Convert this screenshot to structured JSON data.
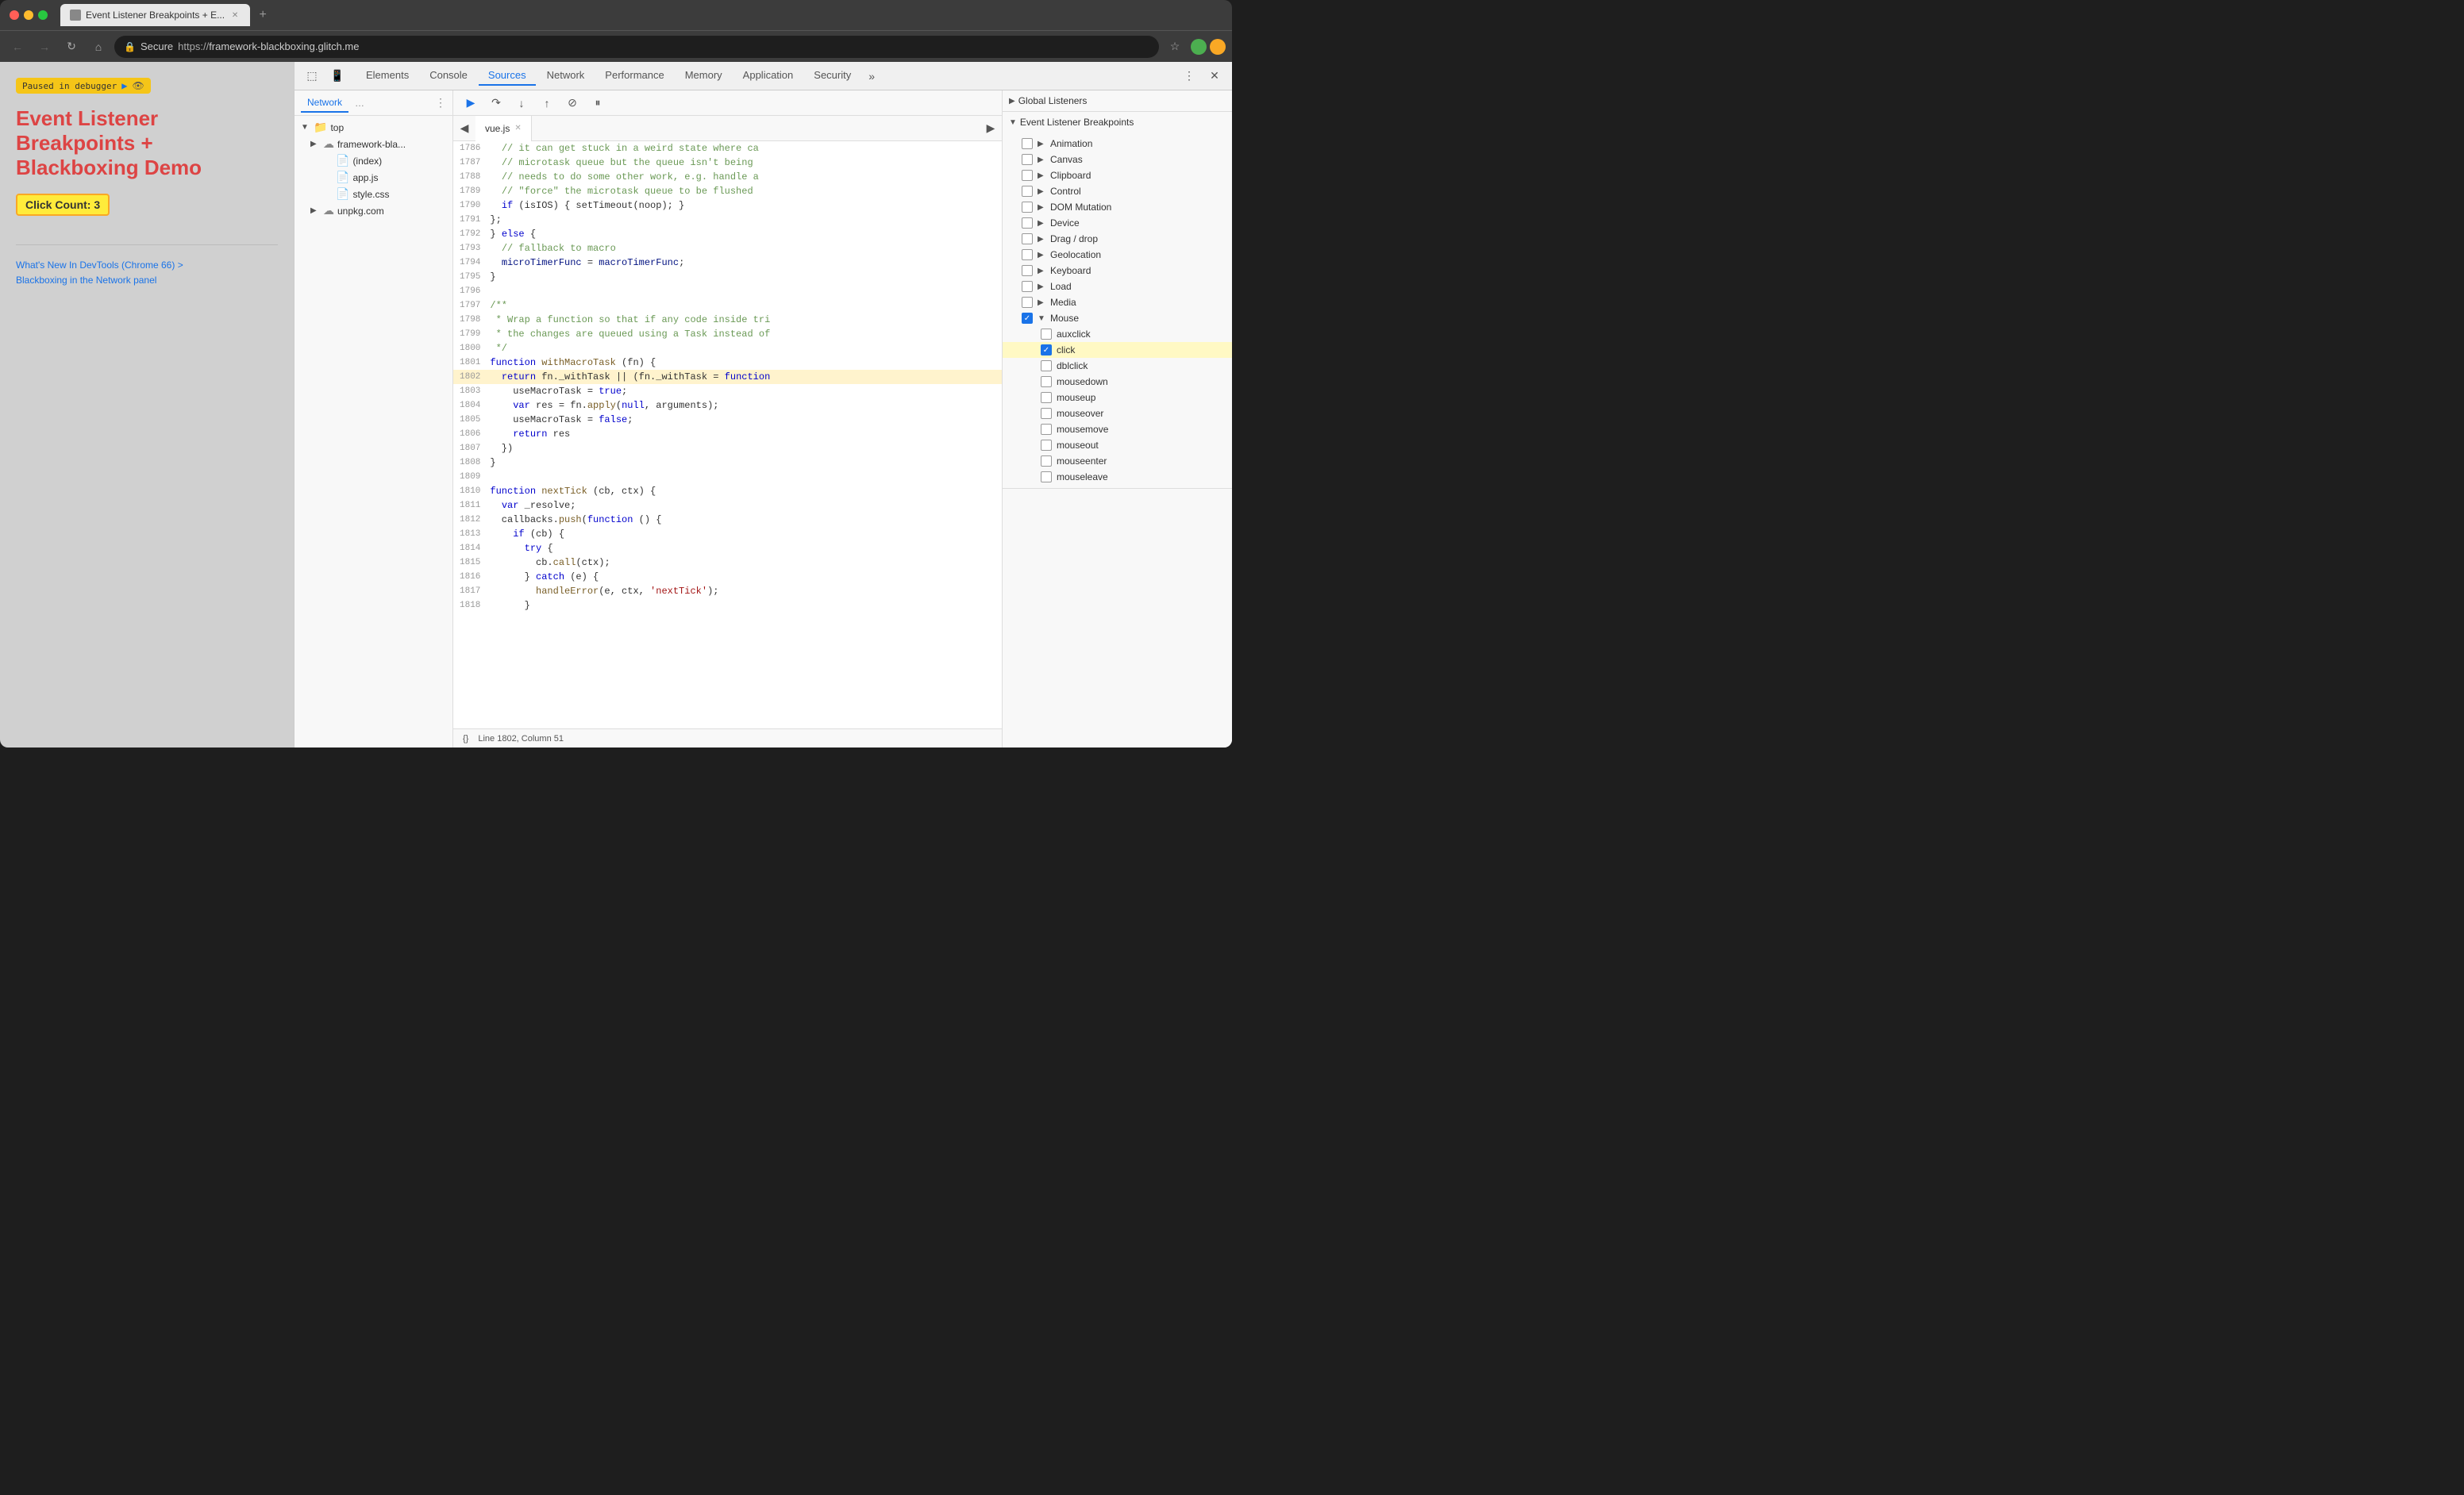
{
  "browser": {
    "title": "Event Listener Breakpoints + E...",
    "url": {
      "protocol": "https://",
      "domain": "framework-blackboxing.glitch.me"
    },
    "secure_label": "Secure"
  },
  "devtools": {
    "tabs": [
      "Elements",
      "Console",
      "Sources",
      "Network",
      "Performance",
      "Memory",
      "Application",
      "Security"
    ],
    "active_tab": "Sources"
  },
  "page": {
    "paused_label": "Paused in debugger",
    "title": "Event Listener Breakpoints + Blackboxing Demo",
    "click_count_label": "Click Count: 3",
    "links": [
      "What's New In DevTools (Chrome 66) >",
      "Blackboxing in the Network panel"
    ]
  },
  "sources_sidebar": {
    "tabs": [
      "Network",
      "..."
    ],
    "tree": [
      {
        "level": 0,
        "type": "folder",
        "label": "top",
        "arrow": "▼"
      },
      {
        "level": 1,
        "type": "cloud-folder",
        "label": "framework-bla...",
        "arrow": "▶"
      },
      {
        "level": 2,
        "type": "file-blue",
        "label": "(index)"
      },
      {
        "level": 2,
        "type": "file-yellow",
        "label": "app.js"
      },
      {
        "level": 2,
        "type": "file-yellow",
        "label": "style.css"
      },
      {
        "level": 1,
        "type": "cloud-folder",
        "label": "unpkg.com",
        "arrow": "▶"
      }
    ]
  },
  "editor": {
    "file_tab": "vue.js",
    "lines": [
      {
        "num": "1786",
        "code": "  // it can get stuck in a weird state where ca",
        "type": "comment"
      },
      {
        "num": "1787",
        "code": "  // microtask queue but the queue isn't being",
        "type": "comment"
      },
      {
        "num": "1788",
        "code": "  // needs to do some other work, e.g. handle a",
        "type": "comment"
      },
      {
        "num": "1789",
        "code": "  // \"force\" the microtask queue to be flushed",
        "type": "comment"
      },
      {
        "num": "1790",
        "code": "  if (isIOS) { setTimeout(noop); }",
        "type": "code"
      },
      {
        "num": "1791",
        "code": "};",
        "type": "code"
      },
      {
        "num": "1792",
        "code": "} else {",
        "type": "code"
      },
      {
        "num": "1793",
        "code": "  // fallback to macro",
        "type": "comment"
      },
      {
        "num": "1794",
        "code": "  microTimerFunc = macroTimerFunc;",
        "type": "code"
      },
      {
        "num": "1795",
        "code": "}",
        "type": "code"
      },
      {
        "num": "1796",
        "code": "",
        "type": "code"
      },
      {
        "num": "1797",
        "code": "/**",
        "type": "comment"
      },
      {
        "num": "1798",
        "code": " * Wrap a function so that if any code inside tri",
        "type": "comment"
      },
      {
        "num": "1799",
        "code": " * the changes are queued using a Task instead of",
        "type": "comment"
      },
      {
        "num": "1800",
        "code": " */",
        "type": "comment"
      },
      {
        "num": "1801",
        "code": "function withMacroTask (fn) {",
        "type": "code"
      },
      {
        "num": "1802",
        "code": "  return fn._withTask || (fn._withTask = function",
        "type": "highlighted"
      },
      {
        "num": "1803",
        "code": "    useMacroTask = true;",
        "type": "code"
      },
      {
        "num": "1804",
        "code": "    var res = fn.apply(null, arguments);",
        "type": "code"
      },
      {
        "num": "1805",
        "code": "    useMacroTask = false;",
        "type": "code"
      },
      {
        "num": "1806",
        "code": "    return res",
        "type": "code"
      },
      {
        "num": "1807",
        "code": "  })",
        "type": "code"
      },
      {
        "num": "1808",
        "code": "}",
        "type": "code"
      },
      {
        "num": "1809",
        "code": "",
        "type": "code"
      },
      {
        "num": "1810",
        "code": "function nextTick (cb, ctx) {",
        "type": "code"
      },
      {
        "num": "1811",
        "code": "  var _resolve;",
        "type": "code"
      },
      {
        "num": "1812",
        "code": "  callbacks.push(function () {",
        "type": "code"
      },
      {
        "num": "1813",
        "code": "    if (cb) {",
        "type": "code"
      },
      {
        "num": "1814",
        "code": "      try {",
        "type": "code"
      },
      {
        "num": "1815",
        "code": "        cb.call(ctx);",
        "type": "code"
      },
      {
        "num": "1816",
        "code": "      } catch (e) {",
        "type": "code"
      },
      {
        "num": "1817",
        "code": "        handleError(e, ctx, 'nextTick');",
        "type": "code"
      },
      {
        "num": "1818",
        "code": "      }",
        "type": "code"
      }
    ],
    "status_bar": "Line 1802, Column 51"
  },
  "right_panel": {
    "global_listeners_label": "Global Listeners",
    "event_breakpoints_label": "Event Listener Breakpoints",
    "categories": [
      {
        "label": "Animation",
        "expanded": false
      },
      {
        "label": "Canvas",
        "expanded": false
      },
      {
        "label": "Clipboard",
        "expanded": false
      },
      {
        "label": "Control",
        "expanded": false
      },
      {
        "label": "DOM Mutation",
        "expanded": false
      },
      {
        "label": "Device",
        "expanded": false
      },
      {
        "label": "Drag / drop",
        "expanded": false
      },
      {
        "label": "Geolocation",
        "expanded": false
      },
      {
        "label": "Keyboard",
        "expanded": false
      },
      {
        "label": "Load",
        "expanded": false
      },
      {
        "label": "Media",
        "expanded": false
      },
      {
        "label": "Mouse",
        "expanded": true
      }
    ],
    "mouse_events": [
      {
        "label": "auxclick",
        "checked": false
      },
      {
        "label": "click",
        "checked": true
      },
      {
        "label": "dblclick",
        "checked": false
      },
      {
        "label": "mousedown",
        "checked": false
      },
      {
        "label": "mouseup",
        "checked": false
      },
      {
        "label": "mouseover",
        "checked": false
      },
      {
        "label": "mousemove",
        "checked": false
      },
      {
        "label": "mouseout",
        "checked": false
      },
      {
        "label": "mouseenter",
        "checked": false
      },
      {
        "label": "mouseleave",
        "checked": false
      }
    ]
  },
  "debugger": {
    "resume_label": "Resume",
    "step_over_label": "Step over",
    "step_into_label": "Step into",
    "step_out_label": "Step out",
    "deactivate_label": "Deactivate breakpoints",
    "pause_on_exceptions_label": "Pause on exceptions"
  }
}
